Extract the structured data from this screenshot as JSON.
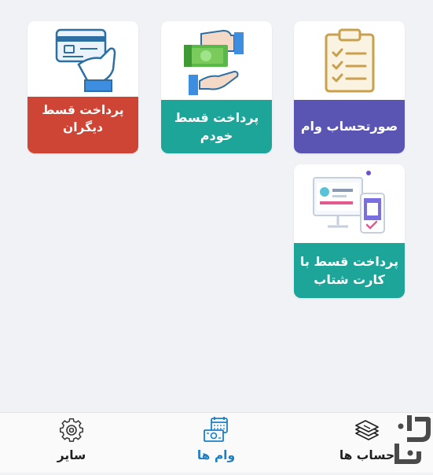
{
  "cards": [
    {
      "label": "صورتحساب وام",
      "color": "#5a55b3",
      "icon": "clipboard-checklist-icon"
    },
    {
      "label": "پرداخت قسط خودم",
      "color": "#1da59a",
      "icon": "money-hand-icon"
    },
    {
      "label": "پرداخت قسط دیگران",
      "color": "#cf4535",
      "icon": "card-payment-icon"
    },
    {
      "label": "پرداخت قسط با کارت شتاب",
      "color": "#1da59a",
      "icon": "devices-card-icon"
    }
  ],
  "nav": [
    {
      "label": "حساب ها",
      "icon": "stacked-cash-icon",
      "active": false
    },
    {
      "label": "وام ها",
      "icon": "loan-calendar-icon",
      "active": true
    },
    {
      "label": "سایر",
      "icon": "gear-icon",
      "active": false
    }
  ],
  "colors": {
    "background": "#f1f2f6",
    "active_nav": "#1c7fc4",
    "logo": "#4a4a4a"
  },
  "logo_icon": "app-logo-icon"
}
